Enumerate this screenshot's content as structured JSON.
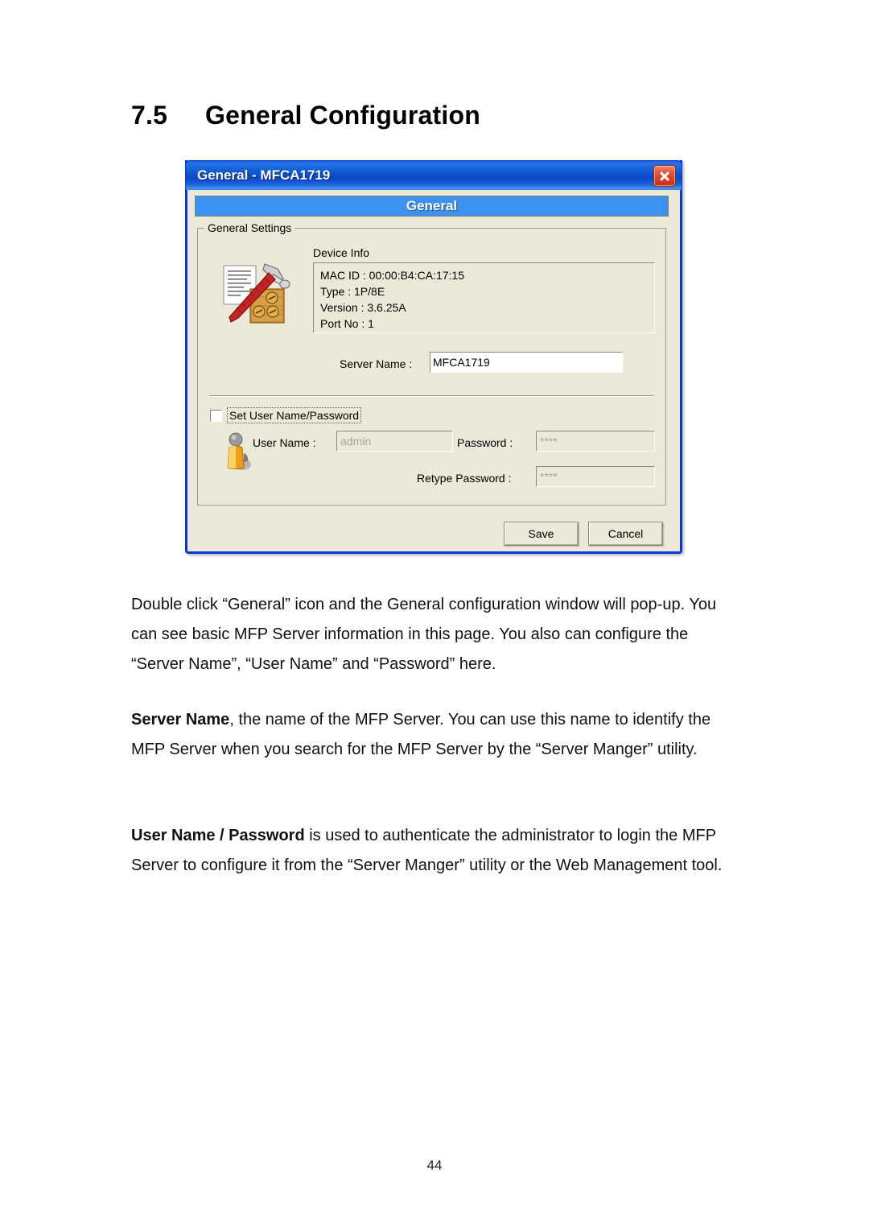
{
  "document": {
    "section_number": "7.5",
    "section_title": "General Configuration",
    "page_number": "44",
    "paragraphs": [
      {
        "id": "intro",
        "runs": [
          {
            "bold": false,
            "text": "Double click “General” icon and the General configuration window will pop-up. You can see basic MFP Server information in this page. You also can configure the “Server Name”, “User Name” and “Password” here."
          }
        ]
      },
      {
        "id": "server-name",
        "runs": [
          {
            "bold": true,
            "text": "Server Name"
          },
          {
            "bold": false,
            "text": ", the name of the MFP Server. You can use this name to identify the MFP Server when you search for the MFP Server by the “Server Manger” utility."
          }
        ]
      },
      {
        "id": "user-name-password",
        "runs": [
          {
            "bold": true,
            "text": "User Name / Password"
          },
          {
            "bold": false,
            "text": " is used to authenticate the administrator to login the MFP Server to configure it from the “Server Manger” utility or the Web Management tool."
          }
        ]
      }
    ]
  },
  "dialog": {
    "title": "General - MFCA1719",
    "close_icon": "close-icon",
    "banner_label": "General",
    "groupbox_title": "General Settings",
    "tools_icon": "tools-hammer-document-icon",
    "person_icon": "user-person-icon",
    "device_info": {
      "label": "Device Info",
      "lines": [
        "MAC ID : 00:00:B4:CA:17:15",
        "Type : 1P/8E",
        "Version : 3.6.25A",
        "Port No : 1"
      ]
    },
    "server_name": {
      "label": "Server Name :",
      "value": "MFCA1719"
    },
    "set_credentials_checkbox": {
      "label": "Set User Name/Password",
      "checked": false
    },
    "credentials": {
      "user_name_label": "User Name :",
      "user_name_value": "admin",
      "password_label": "Password :",
      "password_value": "****",
      "retype_password_label": "Retype Password :",
      "retype_password_value": "****"
    },
    "buttons": {
      "save": "Save",
      "cancel": "Cancel"
    },
    "colors": {
      "titlebar_blue": "#0a46c8",
      "banner_blue": "#3d91f0",
      "dialog_face": "#ece9d8",
      "close_red": "#c62d17",
      "disabled_text": "#a9a694"
    }
  }
}
